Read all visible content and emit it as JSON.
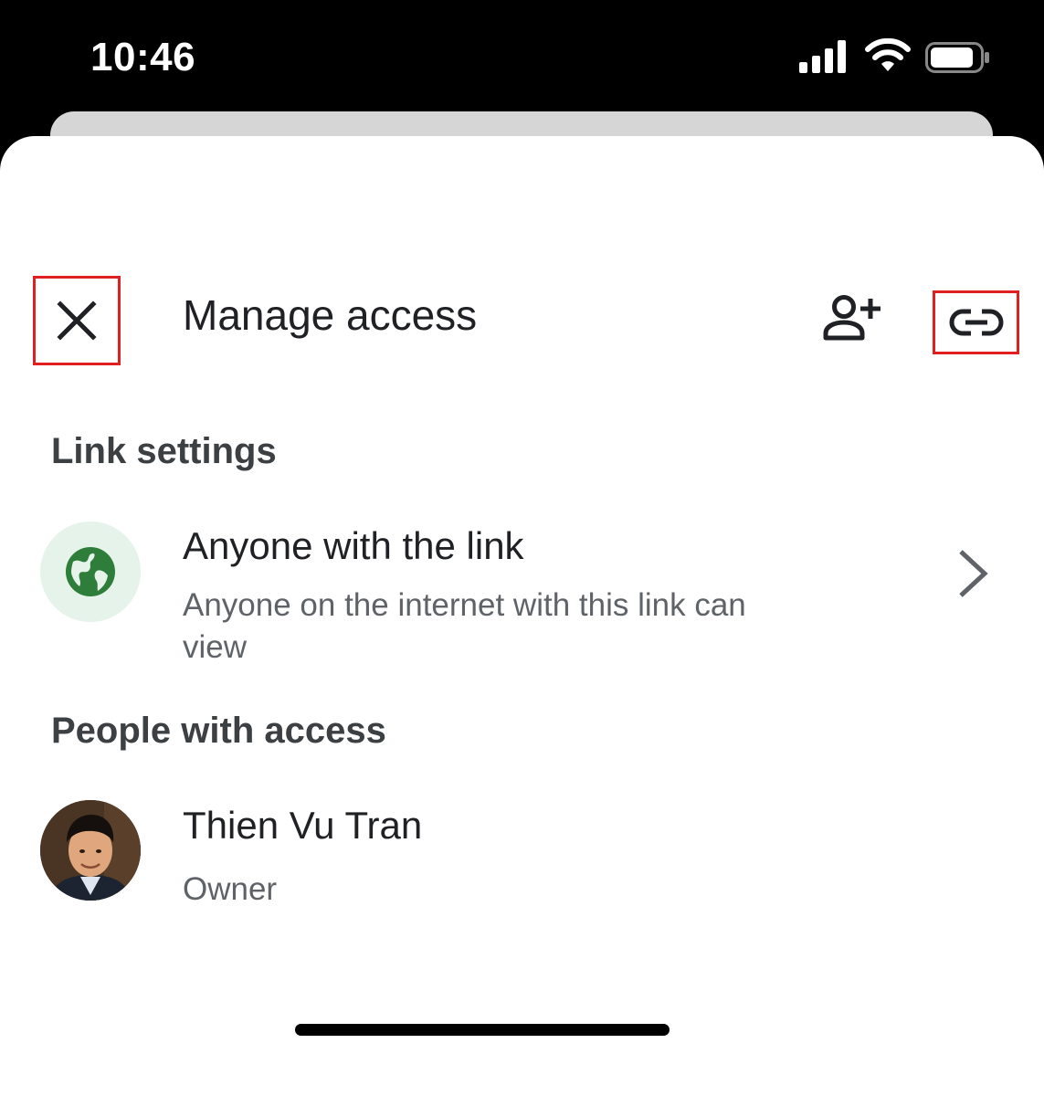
{
  "status_bar": {
    "time": "10:46",
    "icons": [
      "signal-icon",
      "wifi-icon",
      "battery-icon"
    ]
  },
  "header": {
    "close_icon": "close-icon",
    "title": "Manage access",
    "add_person_icon": "person-add-icon",
    "link_icon": "link-icon"
  },
  "link_settings": {
    "heading": "Link settings",
    "icon": "globe-icon",
    "title": "Anyone with the link",
    "description": "Anyone on the internet with this link can view",
    "chevron_icon": "chevron-right-icon"
  },
  "people": {
    "heading": "People with access",
    "items": [
      {
        "name": "Thien Vu Tran",
        "role": "Owner"
      }
    ]
  },
  "colors": {
    "highlight_box": "#e02020",
    "globe_green": "#2f7d3a",
    "globe_bg": "#e6f3ea",
    "primary_text": "#202124",
    "secondary_text": "#5f6368"
  }
}
